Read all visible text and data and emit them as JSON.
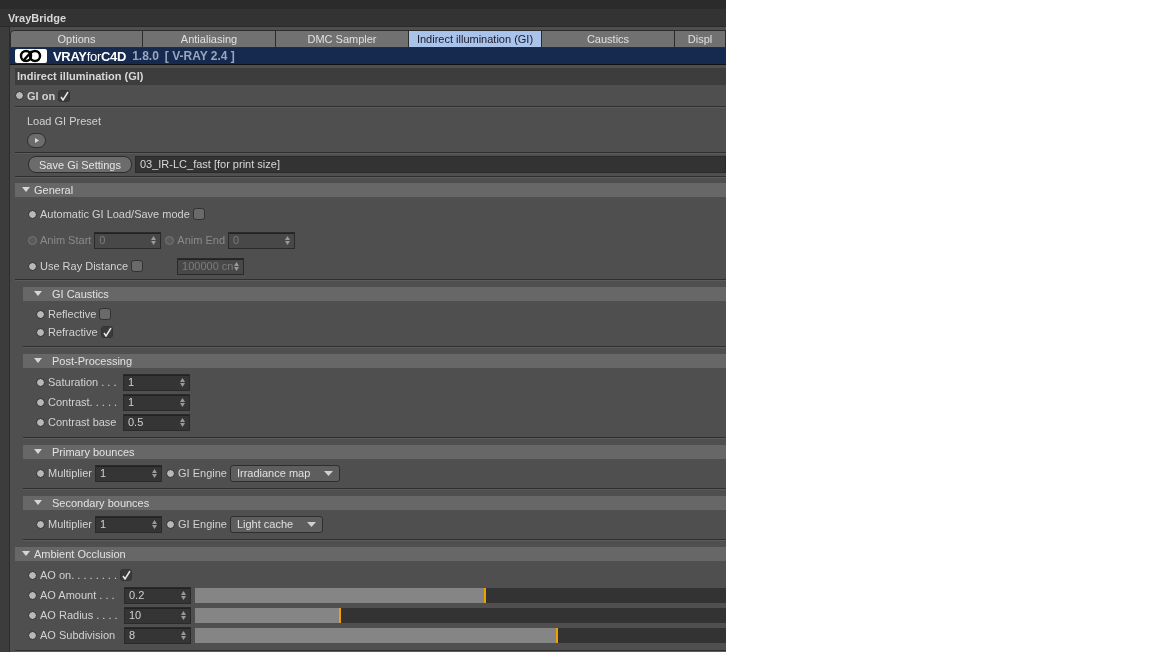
{
  "window": {
    "title": "VrayBridge"
  },
  "tabs": [
    {
      "label": "Options",
      "selected": false
    },
    {
      "label": "Antialiasing",
      "selected": false
    },
    {
      "label": "DMC Sampler",
      "selected": false
    },
    {
      "label": "Indirect illumination (GI)",
      "selected": true
    },
    {
      "label": "Caustics",
      "selected": false
    },
    {
      "label": "Displ",
      "selected": false
    }
  ],
  "banner": {
    "logo": "**VRAY**for**C4D**",
    "version": "1.8.0",
    "engine": "[ V-RAY 2.4 ]"
  },
  "panel": {
    "title": "Indirect illumination (GI)"
  },
  "gi_on": {
    "label": "GI on",
    "checked": true
  },
  "preset": {
    "label": "Load GI Preset"
  },
  "save": {
    "button": "Save Gi Settings",
    "value": "03_IR-LC_fast [for print size]"
  },
  "groups": [
    {
      "title": "General",
      "expanded": true,
      "nested": false,
      "rows": [
        {
          "items": [
            {
              "kind": "check",
              "label": "Automatic GI Load/Save mode",
              "checked": false,
              "disabled": false
            }
          ]
        },
        {
          "items": [
            {
              "kind": "number",
              "label": "Anim Start",
              "value": "0",
              "disabled": true
            },
            {
              "kind": "number",
              "label": "Anim End",
              "value": "0",
              "disabled": true
            }
          ]
        },
        {
          "items": [
            {
              "kind": "check",
              "label": "Use Ray Distance",
              "checked": false,
              "disabled": false
            },
            {
              "kind": "number",
              "value": "100000 cn",
              "disabled": true
            }
          ]
        }
      ]
    },
    {
      "title": "GI Caustics",
      "expanded": true,
      "nested": true,
      "rows": [
        {
          "items": [
            {
              "kind": "check",
              "label": "Reflective",
              "checked": false,
              "disabled": false
            }
          ]
        },
        {
          "items": [
            {
              "kind": "check",
              "label": "Refractive",
              "checked": true,
              "disabled": false
            }
          ]
        }
      ]
    },
    {
      "title": "Post-Processing",
      "expanded": true,
      "nested": true,
      "rows": [
        {
          "items": [
            {
              "kind": "number",
              "label": "Saturation . . .",
              "value": "1",
              "disabled": false
            }
          ]
        },
        {
          "items": [
            {
              "kind": "number",
              "label": "Contrast. . . . .",
              "value": "1",
              "disabled": false
            }
          ]
        },
        {
          "items": [
            {
              "kind": "number",
              "label": "Contrast base",
              "value": "0.5",
              "disabled": false
            }
          ]
        }
      ]
    },
    {
      "title": "Primary bounces",
      "expanded": true,
      "nested": true,
      "rows": [
        {
          "items": [
            {
              "kind": "number",
              "label": "Multiplier",
              "value": "1",
              "disabled": false
            },
            {
              "kind": "dropdown",
              "label": "GI Engine",
              "value": "Irradiance map",
              "disabled": false
            }
          ]
        }
      ]
    },
    {
      "title": "Secondary bounces",
      "expanded": true,
      "nested": true,
      "rows": [
        {
          "items": [
            {
              "kind": "number",
              "label": "Multiplier",
              "value": "1",
              "disabled": false
            },
            {
              "kind": "dropdown",
              "label": "GI Engine",
              "value": "Light cache",
              "disabled": false
            }
          ]
        }
      ]
    },
    {
      "title": "Ambient Occlusion",
      "expanded": true,
      "nested": false,
      "rows": [
        {
          "items": [
            {
              "kind": "check",
              "label": "AO on. . . . . . . .",
              "checked": true,
              "disabled": false
            }
          ]
        },
        {
          "items": [
            {
              "kind": "slider",
              "label": "AO Amount . . .",
              "value": "0.2",
              "level": 0.548,
              "disabled": false
            }
          ]
        },
        {
          "items": [
            {
              "kind": "slider",
              "label": "AO Radius . . . .",
              "value": "10",
              "level": 0.275,
              "disabled": false
            }
          ]
        },
        {
          "items": [
            {
              "kind": "slider",
              "label": "AO Subdivision",
              "value": "8",
              "level": 0.684,
              "disabled": false
            }
          ]
        }
      ]
    }
  ]
}
